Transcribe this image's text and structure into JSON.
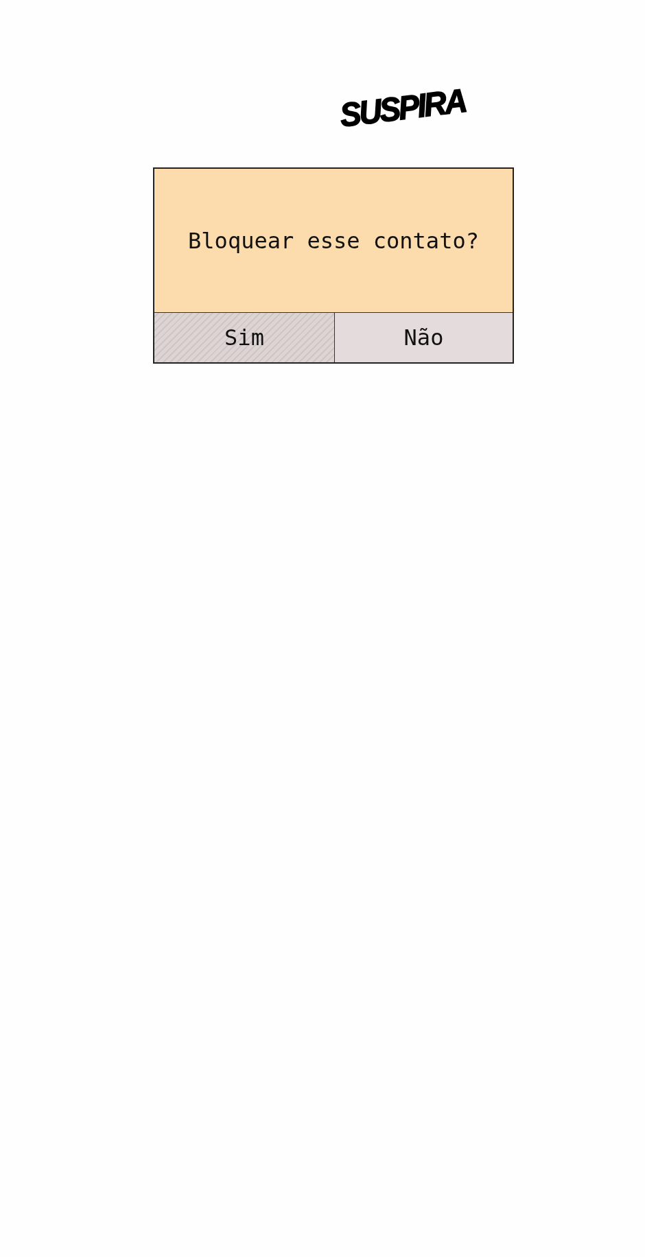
{
  "logo": {
    "text": "SUSPIRA"
  },
  "dialog": {
    "message": "Bloquear esse contato?",
    "buttons": [
      {
        "label": "Sim",
        "selected": true
      },
      {
        "label": "Não",
        "selected": false
      }
    ]
  }
}
